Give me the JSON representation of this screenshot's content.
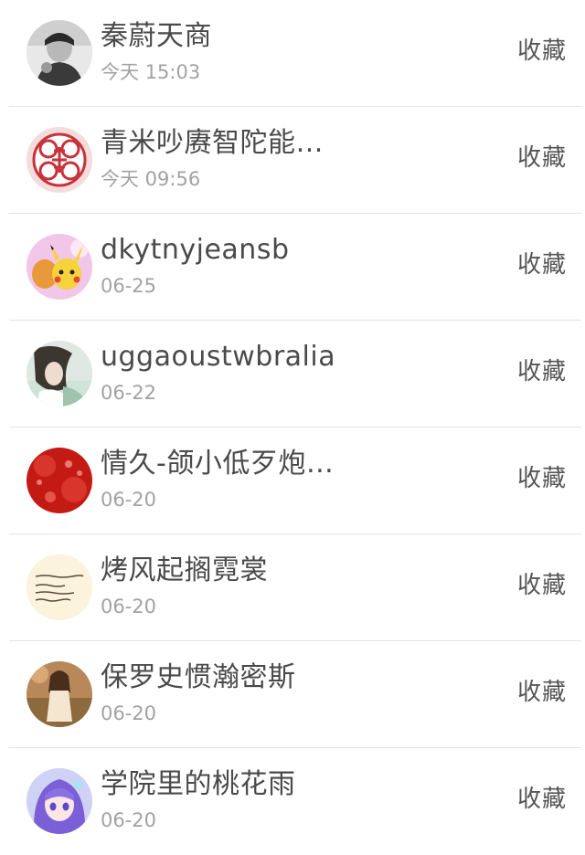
{
  "action_label": "收藏",
  "items": [
    {
      "name": "秦蔚天商",
      "date": "今天 15:03",
      "avatar": "avatar-photo-boy"
    },
    {
      "name": "青米吵赓智陀能…",
      "date": "今天 09:56",
      "avatar": "avatar-fu-character"
    },
    {
      "name": "dkytnyjeansb",
      "date": "06-25",
      "avatar": "avatar-pikachu"
    },
    {
      "name": "uggaoustwbralia",
      "date": "06-22",
      "avatar": "avatar-photo-girl"
    },
    {
      "name": "情久-颌小低歹炮…",
      "date": "06-20",
      "avatar": "avatar-red-hearts"
    },
    {
      "name": "烤风起搁霓裳",
      "date": "06-20",
      "avatar": "avatar-handwritten-note"
    },
    {
      "name": "保罗史惯瀚密斯",
      "date": "06-20",
      "avatar": "avatar-photo-woman"
    },
    {
      "name": "学院里的桃花雨",
      "date": "06-20",
      "avatar": "avatar-anime-girl"
    }
  ]
}
